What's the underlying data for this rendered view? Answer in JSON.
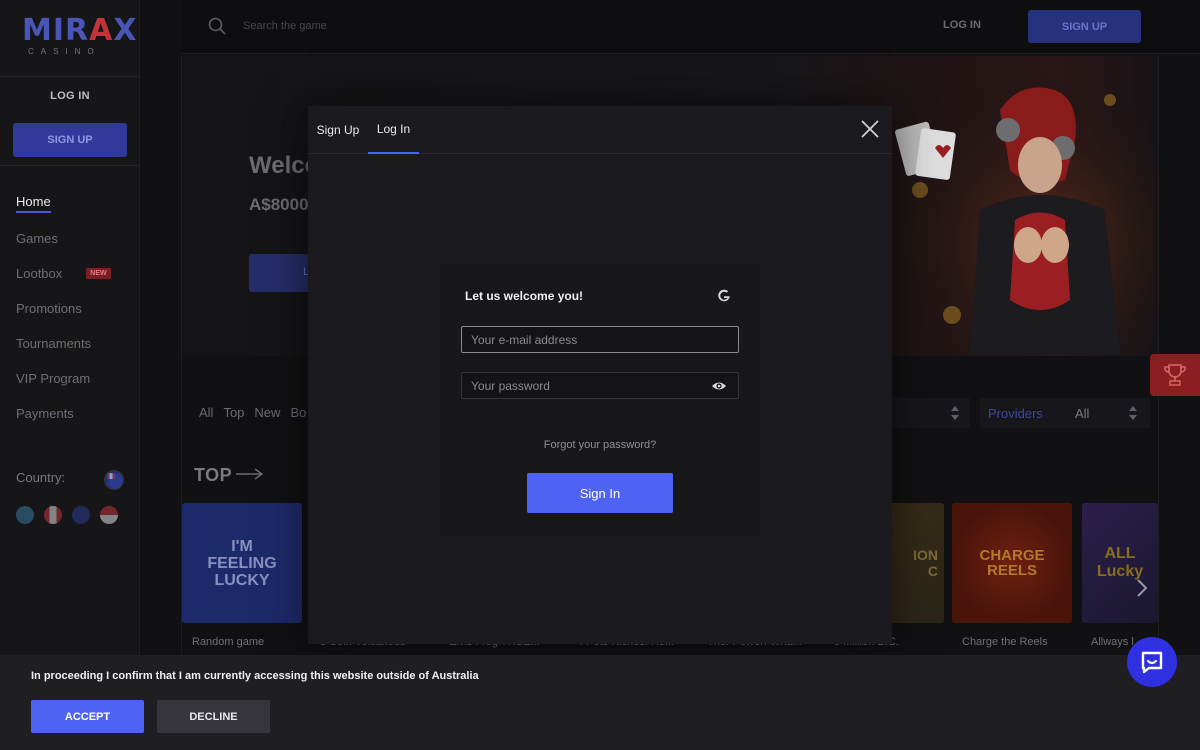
{
  "brand": {
    "logo_main_a": "MIR",
    "logo_main_x": "A",
    "logo_main_b": "X",
    "logo_sub": "CASINO"
  },
  "sidebar": {
    "login_label": "LOG IN",
    "signup_label": "SIGN UP",
    "items": [
      {
        "label": "Home",
        "active": true
      },
      {
        "label": "Games"
      },
      {
        "label": "Lootbox",
        "badge": "NEW"
      },
      {
        "label": "Promotions"
      },
      {
        "label": "Tournaments"
      },
      {
        "label": "VIP Program"
      },
      {
        "label": "Payments"
      }
    ],
    "country_label": "Country:"
  },
  "topbar": {
    "search_placeholder": "Search the game",
    "login_label": "LOG IN",
    "signup_label": "SIGN UP"
  },
  "banner": {
    "title": "Welco",
    "subtitle": "A$8000",
    "button_text": "L"
  },
  "filters": {
    "tabs": [
      "All",
      "Top",
      "New",
      "Bo"
    ],
    "providers_label": "Providers",
    "providers_value": "All"
  },
  "section": {
    "heading": "TOP"
  },
  "games": [
    {
      "label": "Random game",
      "tile_text": "I'M FEELING LUCKY"
    },
    {
      "label": "3 Coin Volcanoes"
    },
    {
      "label": "Elvis Frog TRUE..."
    },
    {
      "label": "4 Pots Riches: Ho..."
    },
    {
      "label": "Thor Power: Wha..."
    },
    {
      "label": "5 Million B.C.",
      "tile_text": "ION\nC"
    },
    {
      "label": "Charge the Reels",
      "tile_text": "CHARGE REELS"
    },
    {
      "label": "Allways l...",
      "tile_text": "ALL Lucky"
    }
  ],
  "modal": {
    "tab_signup": "Sign Up",
    "tab_login": "Log In",
    "title": "Let us welcome you!",
    "email_placeholder": "Your e-mail address",
    "password_placeholder": "Your password",
    "forgot": "Forgot your password?",
    "signin_label": "Sign In"
  },
  "notice": {
    "text": "In proceeding I confirm that I am currently accessing this website outside of Australia",
    "accept_label": "ACCEPT",
    "decline_label": "DECLINE"
  },
  "colors": {
    "accent": "#4f63f2",
    "brand_red": "#c0343a",
    "bg": "#111113"
  }
}
